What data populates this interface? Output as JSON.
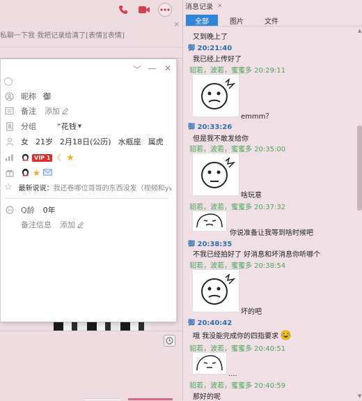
{
  "left_preview_text": "私聊一下我 我把记录给清了[表情][表情]",
  "card": {
    "nickname_label": "昵称",
    "nickname_value": "御",
    "remark_label": "备注",
    "remark_link": "添加",
    "group_label": "分组",
    "group_value": "“花钱",
    "gender": "女",
    "age": "21岁",
    "birthday": "2月18日(公历)",
    "zodiac": "水瓶座",
    "chinese_zodiac": "属虎",
    "vip_badge": "VIP 1",
    "signature_label": "最新说说：",
    "signature_text": "我还卷哪位哥哥的东西没发（视频和yw...",
    "qage_label": "Q龄",
    "qage_value": "0年",
    "remark_info_label": "备注信息",
    "remark_info_link": "添加"
  },
  "right": {
    "tab_title": "消息记录",
    "filter_tabs": [
      "全部",
      "图片",
      "文件"
    ],
    "messages": {
      "m1_text": "又到晚上了",
      "m2_header": "御 20:21:40",
      "m2_text": "我已经上传好了",
      "m3_header": "貂若，波若，蜜蜜多 20:29:11",
      "m3_caption": "emmm？",
      "m4_header": "御 20:33:26",
      "m4_text": "但是我不敢发给你",
      "m5_header": "貂若，波若，蜜蜜多 20:35:00",
      "m5_caption": "啥玩意",
      "m6_header": "貂若，波若，蜜蜜多 20:37:32",
      "m6_caption": "你说准备让我等到啥时候吧",
      "m7_header": "御 20:38:35",
      "m7_text": "不我已经拍好了 好消息和坏消息你听哪个",
      "m8_header": "貂若，波若，蜜蜜多 20:38:54",
      "m8_caption": "坏的吧",
      "m9_header": "御 20:40:42",
      "m9_text": "哦 我没能完成你的四指要求",
      "m10_header": "貂若，波若，蜜蜜多 20:40:51",
      "m10_caption": "....",
      "m11_header": "貂若，波若，蜜蜜多 20:40:59",
      "m11_text": "那好的呢"
    }
  },
  "colors": {
    "tab_active": "#2f86d9",
    "self_name": "#2a6fb3",
    "other_name": "#4aa55a",
    "vip": "#e02b2b",
    "toolbar_icon": "#d2424e"
  }
}
